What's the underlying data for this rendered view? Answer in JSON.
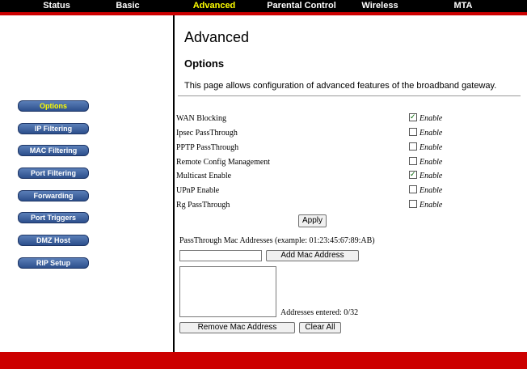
{
  "nav": {
    "tabs": [
      {
        "label": "Status"
      },
      {
        "label": "Basic"
      },
      {
        "label": "Advanced"
      },
      {
        "label": "Parental Control"
      },
      {
        "label": "Wireless"
      },
      {
        "label": "MTA"
      }
    ],
    "active_color": "#ffff00",
    "bar_color": "#000000"
  },
  "accent_red": "#cc0000",
  "sidebar": {
    "items": [
      {
        "label": "Options"
      },
      {
        "label": "IP Filtering"
      },
      {
        "label": "MAC Filtering"
      },
      {
        "label": "Port Filtering"
      },
      {
        "label": "Forwarding"
      },
      {
        "label": "Port Triggers"
      },
      {
        "label": "DMZ Host"
      },
      {
        "label": "RIP Setup"
      }
    ]
  },
  "main": {
    "title": "Advanced",
    "section": "Options",
    "description": "This page allows configuration of advanced features of the broadband gateway.",
    "options": [
      {
        "label": "WAN Blocking",
        "checked": true,
        "check_label": "Enable"
      },
      {
        "label": "Ipsec PassThrough",
        "checked": false,
        "check_label": "Enable"
      },
      {
        "label": "PPTP PassThrough",
        "checked": false,
        "check_label": "Enable"
      },
      {
        "label": "Remote Config Management",
        "checked": false,
        "check_label": "Enable"
      },
      {
        "label": "Multicast Enable",
        "checked": true,
        "check_label": "Enable"
      },
      {
        "label": "UPnP Enable",
        "checked": false,
        "check_label": "Enable"
      },
      {
        "label": "Rg PassThrough",
        "checked": false,
        "check_label": "Enable"
      }
    ],
    "apply_label": "Apply",
    "passthrough_label": "PassThrough Mac Addresses (example: 01:23:45:67:89:AB)",
    "mac_input_value": "",
    "add_mac_label": "Add Mac Address",
    "addresses_entered": "Addresses entered: 0/32",
    "remove_mac_label": "Remove Mac Address",
    "clear_all_label": "Clear All"
  }
}
